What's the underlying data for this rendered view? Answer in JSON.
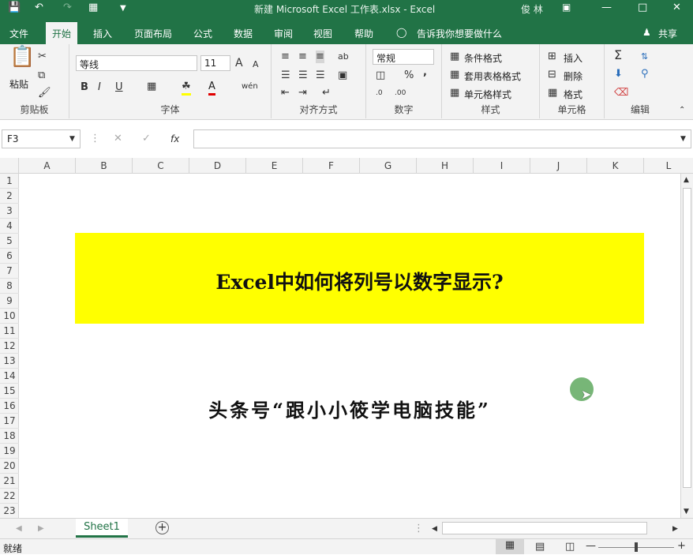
{
  "titlebar": {
    "title": "新建 Microsoft Excel 工作表.xlsx  -  Excel",
    "user": "俊 林"
  },
  "tabs": [
    "文件",
    "开始",
    "插入",
    "页面布局",
    "公式",
    "数据",
    "审阅",
    "视图",
    "帮助"
  ],
  "tellme": "告诉我你想要做什么",
  "share": "共享",
  "clipboard": {
    "paste": "粘贴",
    "label": "剪贴板"
  },
  "font": {
    "name": "等线",
    "size": "11",
    "label": "字体",
    "bold": "B",
    "italic": "I",
    "underline": "U",
    "grow": "A",
    "shrink": "A",
    "phonetic": "wén"
  },
  "align": {
    "label": "对齐方式"
  },
  "number": {
    "format": "常规",
    "percent": "%",
    "comma": ",",
    "label": "数字"
  },
  "styles": {
    "cond": "条件格式",
    "table": "套用表格格式",
    "cell": "单元格样式",
    "label": "样式"
  },
  "cells": {
    "insert": "插入",
    "delete": "删除",
    "format": "格式",
    "label": "单元格"
  },
  "editing": {
    "label": "编辑",
    "sum": "Σ"
  },
  "formula": {
    "namebox": "F3",
    "fx": "fx"
  },
  "columns": [
    "A",
    "B",
    "C",
    "D",
    "E",
    "F",
    "G",
    "H",
    "I",
    "J",
    "K",
    "L"
  ],
  "rows": [
    "1",
    "2",
    "3",
    "4",
    "5",
    "6",
    "7",
    "8",
    "9",
    "10",
    "11",
    "12",
    "13",
    "14",
    "15",
    "16",
    "17",
    "18",
    "19",
    "20",
    "21",
    "22",
    "23"
  ],
  "content": {
    "title": "Excel中如何将列号以数字显示?",
    "subtitle": "头条号“跟小小筱学电脑技能”"
  },
  "sheet": {
    "name": "Sheet1",
    "add": "+"
  },
  "status": {
    "ready": "就绪"
  }
}
